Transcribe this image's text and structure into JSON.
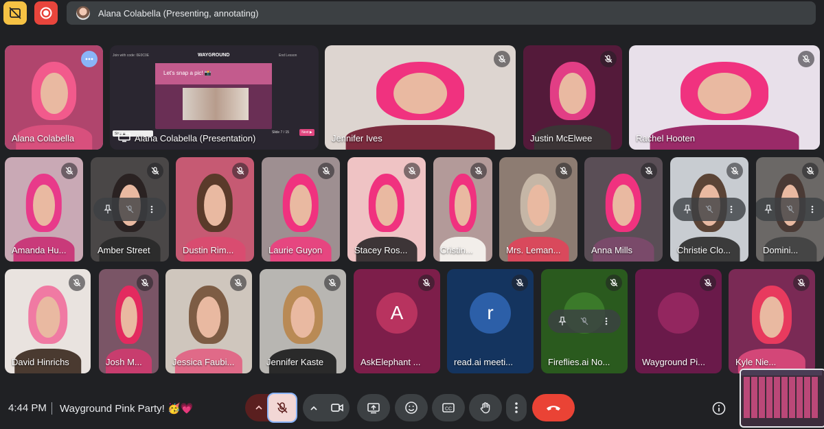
{
  "topbar": {
    "presenting_text": "Alana Colabella (Presenting, annotating)",
    "icons": [
      "captions-off-icon",
      "record-icon"
    ],
    "colors": {
      "captions_btn": "#f6c244",
      "record_btn": "#e8453c",
      "bar": "#3c4043"
    }
  },
  "presentation": {
    "join_text": "Join with code: 0E0C0E",
    "brand": "WAYGROUND",
    "slide_title": "Let's snap a pic! 📸",
    "slide_counter": "Slide 7 / 15",
    "next_label": "Next ▶",
    "end_label": "End Lesson",
    "stop_btn": "Stop ◼",
    "label": "Alana Colabella (Presentation)"
  },
  "participants": [
    {
      "name": "Alana Colabella",
      "kind": "video",
      "bg": "#b0456d",
      "hair": "#f25a8c",
      "shirt": "#d8507d",
      "speaking": true
    },
    {
      "name": "Jennifer Ives",
      "kind": "video",
      "bg": "#ddd5d0",
      "hair": "#f0327f",
      "shirt": "#7a2a3d"
    },
    {
      "name": "Justin McElwee",
      "kind": "video",
      "bg": "#541a3a",
      "hair": "#e23e85",
      "shirt": "#3b3436"
    },
    {
      "name": "Rachel Hooten",
      "kind": "video",
      "bg": "#e8e0ea",
      "hair": "#f0327f",
      "shirt": "#9a2a68"
    },
    {
      "name": "Amanda Hu...",
      "kind": "video",
      "bg": "#c9a9b5",
      "hair": "#e83a8a",
      "shirt": "#c93a7a"
    },
    {
      "name": "Amber Street",
      "kind": "video",
      "bg": "#4a4747",
      "hair": "#2a2222",
      "shirt": "#2c2c2c"
    },
    {
      "name": "Dustin Rim...",
      "kind": "video",
      "bg": "#c65a73",
      "hair": "#5a3a2a",
      "shirt": "#d94c70"
    },
    {
      "name": "Laurie Guyon",
      "kind": "video",
      "bg": "#9e8f91",
      "hair": "#f0327f",
      "shirt": "#e64680"
    },
    {
      "name": "Stacey Ros...",
      "kind": "video",
      "bg": "#efc3c4",
      "hair": "#f0327f",
      "shirt": "#3d3537"
    },
    {
      "name": "Cristin...",
      "kind": "video",
      "bg": "#b39a99",
      "hair": "#f0327f",
      "shirt": "#f2eeea"
    },
    {
      "name": "Mrs. Leman...",
      "kind": "video",
      "bg": "#8d7c72",
      "hair": "#c5b6a6",
      "shirt": "#d9495c"
    },
    {
      "name": "Anna Mills",
      "kind": "video",
      "bg": "#5a4e56",
      "hair": "#f0327f",
      "shirt": "#7a4a6a"
    },
    {
      "name": "Christie Clo...",
      "kind": "video",
      "bg": "#c8ccd1",
      "hair": "#5b4436",
      "shirt": "#3b3b3b"
    },
    {
      "name": "Domini...",
      "kind": "video",
      "bg": "#6b6866",
      "hair": "#4a3a35",
      "shirt": "#454545"
    },
    {
      "name": "David Hinrichs",
      "kind": "video",
      "bg": "#e9e3df",
      "hair": "#f07aa3",
      "shirt": "#4a3a30"
    },
    {
      "name": "Josh M...",
      "kind": "video",
      "bg": "#7a5566",
      "hair": "#e32a5f",
      "shirt": "#c83d6e"
    },
    {
      "name": "Jessica Faubi...",
      "kind": "video",
      "bg": "#cfc6bd",
      "hair": "#7d5c44",
      "shirt": "#e06a88"
    },
    {
      "name": "Jennifer Kaste",
      "kind": "video",
      "bg": "#b8b6b2",
      "hair": "#b98a55",
      "shirt": "#2a2a2a"
    },
    {
      "name": "AskElephant ...",
      "kind": "avatar",
      "letter": "A",
      "bg": "#7d1e4a",
      "avatar_color": "#b8335f"
    },
    {
      "name": "read.ai meeti...",
      "kind": "avatar",
      "letter": "r",
      "bg": "#14345f",
      "avatar_color": "#2c5fa8"
    },
    {
      "name": "Fireflies.ai No...",
      "kind": "avatar",
      "letter": "",
      "bg": "#2a5a1e",
      "avatar_color": "#3b7a2a"
    },
    {
      "name": "Wayground Pi...",
      "kind": "avatar",
      "letter": "",
      "bg": "#6a1a4a",
      "avatar_color": "#93265f"
    },
    {
      "name": "Kyle Nie...",
      "kind": "video",
      "bg": "#7a2a55",
      "hair": "#e83a5e",
      "shirt": "#d34778"
    }
  ],
  "bottombar": {
    "time": "4:44 PM",
    "meeting_title": "Wayground Pink Party! 🥳💗",
    "controls": [
      {
        "name": "mic-options",
        "icon": "chevron-up-icon"
      },
      {
        "name": "mic-toggle",
        "icon": "mic-off-icon"
      },
      {
        "name": "camera-options",
        "icon": "chevron-up-icon"
      },
      {
        "name": "camera-toggle",
        "icon": "camera-icon"
      },
      {
        "name": "present",
        "icon": "present-icon"
      },
      {
        "name": "reactions",
        "icon": "emoji-icon"
      },
      {
        "name": "captions",
        "icon": "captions-icon"
      },
      {
        "name": "raise-hand",
        "icon": "hand-icon"
      },
      {
        "name": "more-options",
        "icon": "more-vert-icon"
      },
      {
        "name": "leave-call",
        "icon": "hangup-icon"
      },
      {
        "name": "meeting-info",
        "icon": "info-icon"
      }
    ],
    "colors": {
      "mic_off": "#8a2a2a",
      "leave": "#ea4335",
      "ctrl_bg": "#3c4043"
    }
  }
}
